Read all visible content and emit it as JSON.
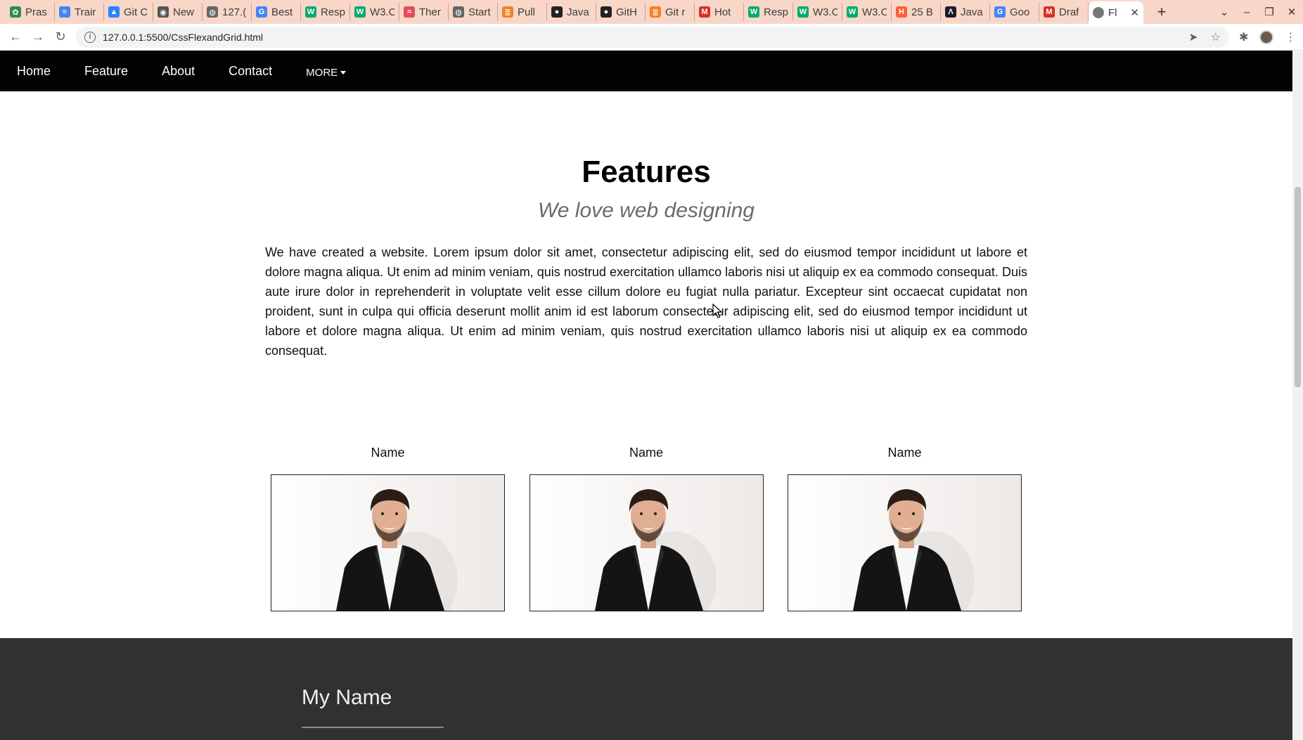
{
  "browser": {
    "tabs": [
      {
        "title": "Pras",
        "icon": "leaf-icon",
        "color": "#2e8b57"
      },
      {
        "title": "Trair",
        "icon": "docs-icon",
        "color": "#4285f4"
      },
      {
        "title": "Git C",
        "icon": "atlassian-icon",
        "color": "#2684ff"
      },
      {
        "title": "New",
        "icon": "chrome-icon",
        "color": "#555555"
      },
      {
        "title": "127.(",
        "icon": "globe-icon",
        "color": "#666666"
      },
      {
        "title": "Best",
        "icon": "google-icon",
        "color": "#4285f4"
      },
      {
        "title": "Resp",
        "icon": "w3schools-icon",
        "color": "#04aa6d"
      },
      {
        "title": "W3.C",
        "icon": "w3schools-icon",
        "color": "#04aa6d"
      },
      {
        "title": "Ther",
        "icon": "wave-icon",
        "color": "#e94b5b"
      },
      {
        "title": "Start",
        "icon": "globe-icon",
        "color": "#666666"
      },
      {
        "title": "Pull",
        "icon": "stack-icon",
        "color": "#f48024"
      },
      {
        "title": "Java",
        "icon": "github-icon",
        "color": "#222222"
      },
      {
        "title": "GitH",
        "icon": "github-icon",
        "color": "#222222"
      },
      {
        "title": "Git r",
        "icon": "stack-icon",
        "color": "#f48024"
      },
      {
        "title": "Hot",
        "icon": "gmail-icon",
        "color": "#d93025"
      },
      {
        "title": "Resp",
        "icon": "w3schools-icon",
        "color": "#04aa6d"
      },
      {
        "title": "W3.C",
        "icon": "w3schools-icon",
        "color": "#04aa6d"
      },
      {
        "title": "W3.C",
        "icon": "w3schools-icon",
        "color": "#04aa6d"
      },
      {
        "title": "25 B",
        "icon": "hubspot-icon",
        "color": "#ff5c35"
      },
      {
        "title": "Java",
        "icon": "jd-icon",
        "color": "#1a1a2e"
      },
      {
        "title": "Goo",
        "icon": "google-icon",
        "color": "#4285f4"
      },
      {
        "title": "Draf",
        "icon": "gmail-icon",
        "color": "#d93025"
      }
    ],
    "active_tab": {
      "title": "Fl",
      "icon": "globe-icon"
    },
    "new_tab": "+",
    "url": "127.0.0.1:5500/CssFlexandGrid.html"
  },
  "nav": {
    "items": [
      "Home",
      "Feature",
      "About",
      "Contact"
    ],
    "more": "MORE"
  },
  "features": {
    "title": "Features",
    "subtitle": "We love web designing",
    "paragraph": "We have created a website. Lorem ipsum dolor sit amet, consectetur adipiscing elit, sed do eiusmod tempor incididunt ut labore et dolore magna aliqua. Ut enim ad minim veniam, quis nostrud exercitation ullamco laboris nisi ut aliquip ex ea commodo consequat. Duis aute irure dolor in reprehenderit in voluptate velit esse cillum dolore eu fugiat nulla pariatur. Excepteur sint occaecat cupidatat non proident, sunt in culpa qui officia deserunt mollit anim id est laborum consectetur adipiscing elit, sed do eiusmod tempor incididunt ut labore et dolore magna aliqua. Ut enim ad minim veniam, quis nostrud exercitation ullamco laboris nisi ut aliquip ex ea commodo consequat."
  },
  "cards": [
    {
      "name": "Name"
    },
    {
      "name": "Name"
    },
    {
      "name": "Name"
    }
  ],
  "footer": {
    "title": "My Name"
  }
}
